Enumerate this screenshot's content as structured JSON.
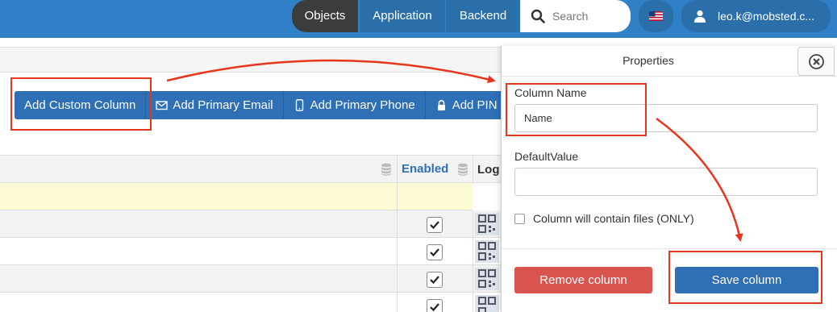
{
  "nav": {
    "items": [
      {
        "label": "Objects"
      },
      {
        "label": "Application"
      },
      {
        "label": "Backend"
      }
    ],
    "search_placeholder": "Search",
    "user_label": "leo.k@mobsted.c..."
  },
  "toolbar": {
    "buttons": [
      {
        "label": "Add Custom Column",
        "icon": "none"
      },
      {
        "label": "Add Primary Email",
        "icon": "envelope-icon"
      },
      {
        "label": "Add Primary Phone",
        "icon": "mobile-phone-icon"
      },
      {
        "label": "Add PIN",
        "icon": "lock-icon"
      }
    ]
  },
  "table": {
    "columns": [
      {
        "label": "Enabled"
      },
      {
        "label": "Log"
      }
    ],
    "rows": [
      {
        "enabled": true
      },
      {
        "enabled": true
      },
      {
        "enabled": true
      },
      {
        "enabled": true
      }
    ]
  },
  "panel": {
    "title": "Properties",
    "column_name_label": "Column Name",
    "column_name_value": "Name",
    "default_value_label": "DefaultValue",
    "default_value_value": "",
    "files_label": "Column will contain files (ONLY)",
    "files_checked": false,
    "remove_label": "Remove column",
    "save_label": "Save column"
  },
  "colors": {
    "topbar": "#2f80c6",
    "nav_active": "#3c3c3c",
    "primary": "#2e6fb5",
    "danger": "#d9534f",
    "annotation": "#e8361c",
    "enabled_header": "#2e6fb5",
    "highlight_row": "#fcfbd3"
  }
}
